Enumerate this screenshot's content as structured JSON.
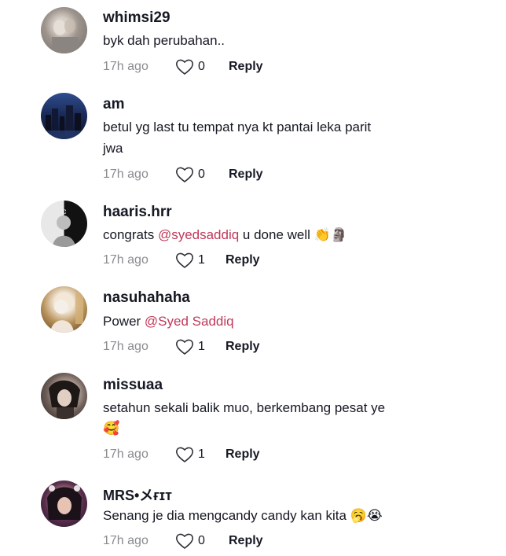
{
  "comments": [
    {
      "username": "whimsi29",
      "text_plain": "byk dah perubahan..",
      "time": "17h ago",
      "likes": "0",
      "reply": "Reply"
    },
    {
      "username": "am",
      "text_line1": "betul yg last tu tempat nya kt pantai leka parit",
      "text_line2": "jwa",
      "time": "17h ago",
      "likes": "0",
      "reply": "Reply"
    },
    {
      "username": "haaris.hrr",
      "text_pre": "congrats ",
      "mention": "@syedsaddiq",
      "text_post": " u done well ",
      "emoji": "👏🗿",
      "time": "17h ago",
      "likes": "1",
      "reply": "Reply"
    },
    {
      "username": "nasuhahaha",
      "text_pre": "Power ",
      "mention": "@Syed Saddiq",
      "time": "17h ago",
      "likes": "1",
      "reply": "Reply"
    },
    {
      "username": "missuaa",
      "text_line1": "setahun sekali balik muo, berkembang pesat ye",
      "emoji": "🥰",
      "time": "17h ago",
      "likes": "1",
      "reply": "Reply"
    },
    {
      "username": "MRS•メғɪᴛ",
      "text_pre": "Senang je dia mengcandy candy kan kita ",
      "emoji": "🥱😭",
      "time": "17h ago",
      "likes": "0",
      "reply": "Reply"
    }
  ],
  "colors": {
    "mention": "#c0395a",
    "muted": "#8a8b91",
    "text": "#161823"
  },
  "icons": {
    "like": "heart-outline-icon"
  }
}
